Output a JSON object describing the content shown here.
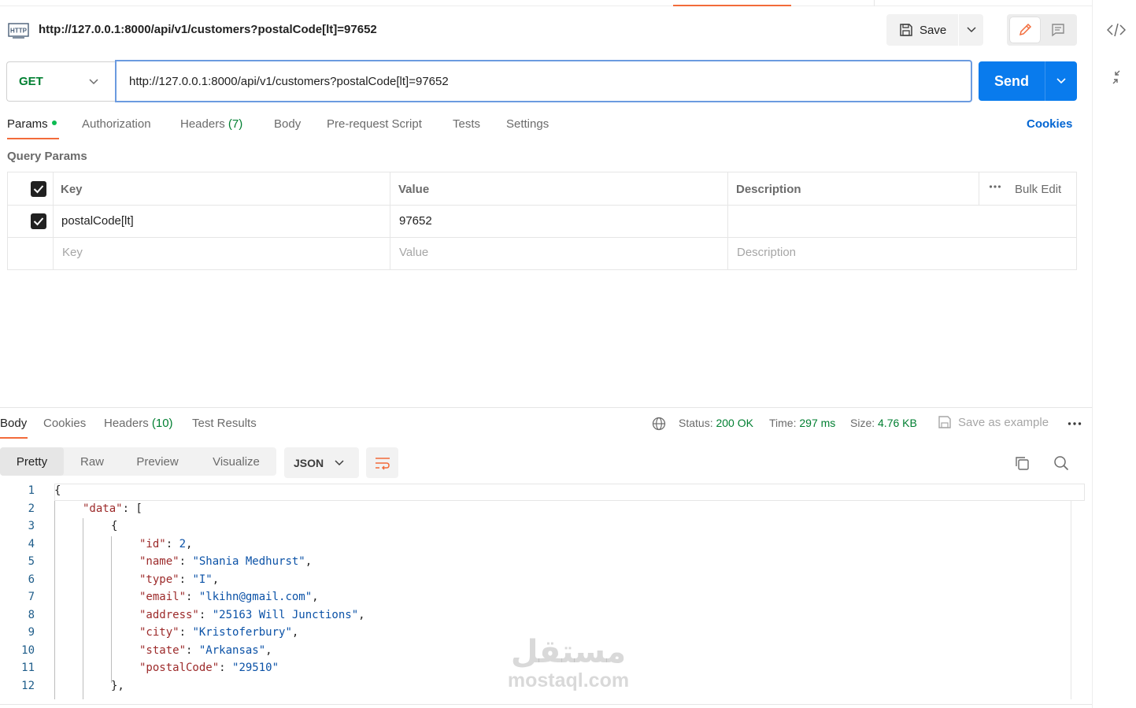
{
  "request": {
    "title": "http://127.0.0.1:8000/api/v1/customers?postalCode[lt]=97652",
    "save_label": "Save",
    "method": "GET",
    "url": "http://127.0.0.1:8000/api/v1/customers?postalCode[lt]=97652",
    "send_label": "Send"
  },
  "request_tabs": [
    {
      "label": "Params"
    },
    {
      "label": "Authorization"
    },
    {
      "label": "Headers",
      "count": "(7)"
    },
    {
      "label": "Body"
    },
    {
      "label": "Pre-request Script"
    },
    {
      "label": "Tests"
    },
    {
      "label": "Settings"
    }
  ],
  "cookies_label": "Cookies",
  "query_params": {
    "title": "Query Params",
    "headers": {
      "key": "Key",
      "value": "Value",
      "description": "Description"
    },
    "bulk_edit": "Bulk Edit",
    "rows": [
      {
        "checked": true,
        "key": "postalCode[lt]",
        "value": "97652",
        "description": ""
      }
    ],
    "placeholders": {
      "key": "Key",
      "value": "Value",
      "description": "Description"
    }
  },
  "response": {
    "tabs": [
      {
        "label": "Body"
      },
      {
        "label": "Cookies"
      },
      {
        "label": "Headers",
        "count": "(10)"
      },
      {
        "label": "Test Results"
      }
    ],
    "status_label": "Status:",
    "status_value": "200 OK",
    "time_label": "Time:",
    "time_value": "297 ms",
    "size_label": "Size:",
    "size_value": "4.76 KB",
    "save_example": "Save as example",
    "views": [
      "Pretty",
      "Raw",
      "Preview",
      "Visualize"
    ],
    "format": "JSON",
    "line_numbers": [
      "1",
      "2",
      "3",
      "4",
      "5",
      "6",
      "7",
      "8",
      "9",
      "10",
      "11",
      "12"
    ],
    "body": {
      "l1": "{",
      "l2_key": "\"data\"",
      "l2_rest": ": [",
      "l3": "{",
      "fields": [
        {
          "key": "\"id\"",
          "value": "2",
          "kind": "n"
        },
        {
          "key": "\"name\"",
          "value": "\"Shania Medhurst\"",
          "kind": "s"
        },
        {
          "key": "\"type\"",
          "value": "\"I\"",
          "kind": "s"
        },
        {
          "key": "\"email\"",
          "value": "\"lkihn@gmail.com\"",
          "kind": "s"
        },
        {
          "key": "\"address\"",
          "value": "\"25163 Will Junctions\"",
          "kind": "s"
        },
        {
          "key": "\"city\"",
          "value": "\"Kristoferbury\"",
          "kind": "s"
        },
        {
          "key": "\"state\"",
          "value": "\"Arkansas\"",
          "kind": "s"
        },
        {
          "key": "\"postalCode\"",
          "value": "\"29510\"",
          "kind": "s",
          "last": true
        }
      ],
      "l12": "},"
    }
  },
  "watermark": {
    "arabic": "مستقل",
    "latin": "mostaql.com"
  },
  "colors": {
    "accent": "#f26b3a",
    "send": "#097bed",
    "method": "#007f31",
    "status": "#007f31",
    "link": "#0265d2"
  }
}
